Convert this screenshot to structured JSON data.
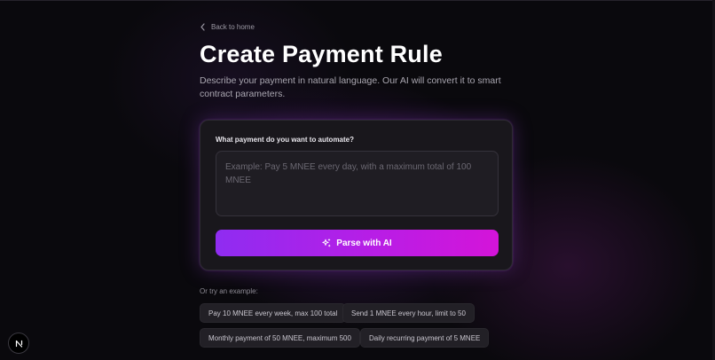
{
  "nav": {
    "back_label": "Back to home"
  },
  "header": {
    "title": "Create Payment Rule",
    "description": "Describe your payment in natural language. Our AI will convert it to smart contract parameters."
  },
  "form": {
    "label": "What payment do you want to automate?",
    "input_value": "",
    "placeholder": "Example: Pay 5 MNEE every day, with a maximum total of 100 MNEE",
    "parse_button_label": "Parse with AI",
    "parse_button_icon": "sparkles-icon"
  },
  "examples": {
    "label": "Or try an example:",
    "items": [
      "Pay 10 MNEE every week, max 100 total",
      "Send 1 MNEE every hour, limit to 50",
      "Monthly payment of 50 MNEE, maximum 500",
      "Daily recurring payment of 5 MNEE"
    ]
  },
  "dev_badge": {
    "icon": "nextjs-logo-icon"
  },
  "colors": {
    "background": "#0a090d",
    "card": "#19171c",
    "accent_start": "#8f2cf1",
    "accent_end": "#d414d9",
    "glow": "#8c3cc8"
  }
}
